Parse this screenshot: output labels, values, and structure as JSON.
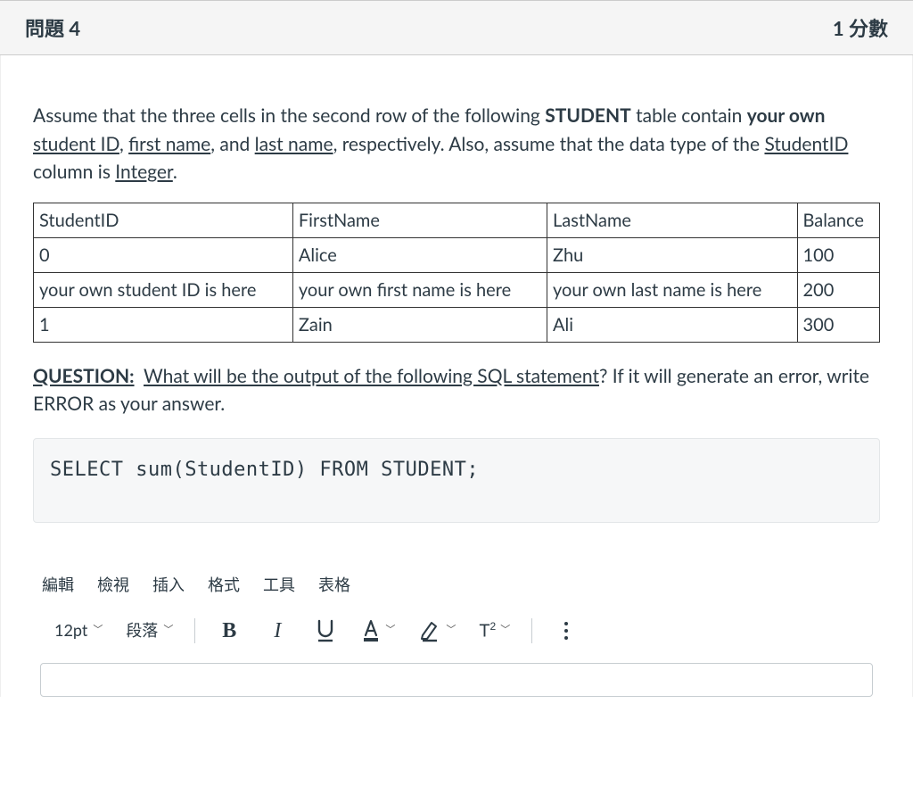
{
  "header": {
    "title": "問題 4",
    "points": "1 分數"
  },
  "prompt": {
    "p1_a": "Assume that the three cells in the second row of the following ",
    "p1_bold": "STUDENT",
    "p1_b": " table contain ",
    "p1_bold2": "your own",
    "p1_c": " ",
    "u1": "student ID",
    "sep": ", ",
    "u2": "first name",
    "and_": ", and ",
    "u3": "last name",
    "p1_d": ", respectively. Also, assume that the data type of the ",
    "u4": "StudentID",
    "p1_e": " column  is ",
    "u5": "Integer",
    "dot": "."
  },
  "table": {
    "headers": [
      "StudentID",
      "FirstName",
      "LastName",
      "Balance"
    ],
    "rows": [
      [
        "0",
        "Alice",
        "Zhu",
        "100"
      ],
      [
        "your own student ID is here",
        "your own first name is here",
        "your own last name is here",
        "200"
      ],
      [
        "1",
        "Zain",
        "Ali",
        "300"
      ]
    ]
  },
  "question": {
    "label": "QUESTION:",
    "text": "What will be the output of the following SQL statement",
    "tail": "? If it will generate an error, write ERROR as your answer."
  },
  "code": "SELECT sum(StudentID) FROM STUDENT;",
  "menubar": [
    "編輯",
    "檢視",
    "插入",
    "格式",
    "工具",
    "表格"
  ],
  "toolbar": {
    "fontsize": "12pt",
    "blocktype": "段落"
  }
}
